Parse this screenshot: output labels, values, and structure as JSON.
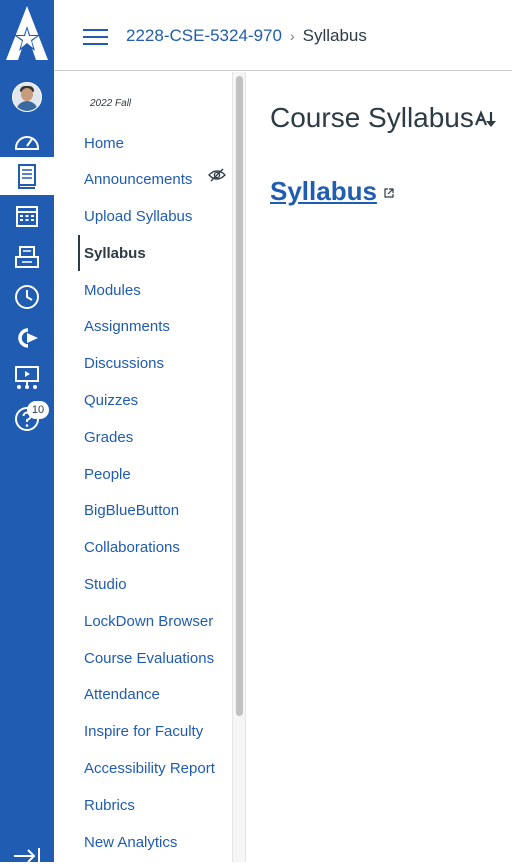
{
  "colors": {
    "brand": "#1f5cb2",
    "text": "#2d3b45",
    "nav_bg": "#1f5cb2"
  },
  "global_nav": {
    "items": [
      {
        "name": "account",
        "icon": "avatar"
      },
      {
        "name": "dashboard",
        "icon": "dashboard-icon"
      },
      {
        "name": "courses",
        "icon": "book-icon",
        "active": true
      },
      {
        "name": "calendar",
        "icon": "calendar-icon"
      },
      {
        "name": "inbox",
        "icon": "inbox-icon"
      },
      {
        "name": "history",
        "icon": "clock-icon"
      },
      {
        "name": "commons",
        "icon": "commons-icon"
      },
      {
        "name": "studio",
        "icon": "presentation-icon"
      },
      {
        "name": "help",
        "icon": "help-icon",
        "badge": "10"
      }
    ]
  },
  "breadcrumb": {
    "course": "2228-CSE-5324-970",
    "separator": "›",
    "current": "Syllabus"
  },
  "course_nav": {
    "term": "2022 Fall",
    "items": [
      "Home",
      "Announcements",
      "Upload Syllabus",
      "Syllabus",
      "Modules",
      "Assignments",
      "Discussions",
      "Quizzes",
      "Grades",
      "People",
      "BigBlueButton",
      "Collaborations",
      "Studio",
      "LockDown Browser",
      "Course Evaluations",
      "Attendance",
      "Inspire for Faculty",
      "Accessibility Report",
      "Rubrics",
      "New Analytics"
    ],
    "active": "Syllabus"
  },
  "main": {
    "title": "Course Syllabus",
    "link_text": "Syllabus"
  }
}
